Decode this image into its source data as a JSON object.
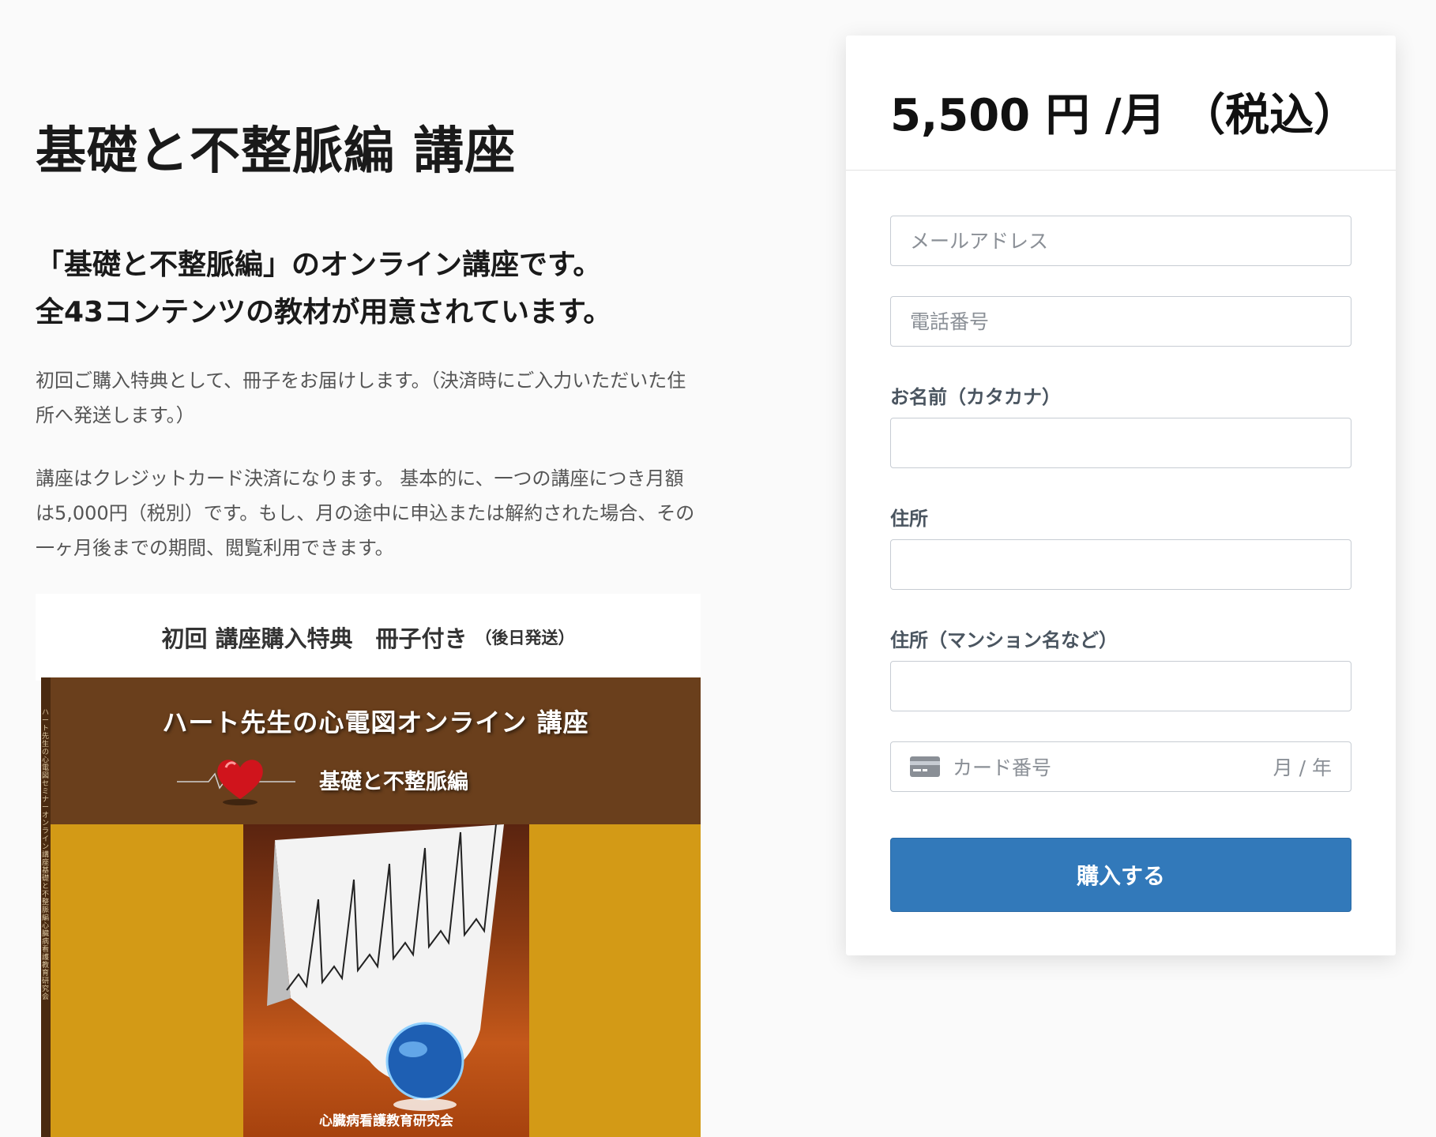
{
  "page": {
    "title": "基礎と不整脈編 講座",
    "lead_line1": "「基礎と不整脈編」のオンライン講座です。",
    "lead_line2": "全43コンテンツの教材が用意されています。",
    "para1": "初回ご購入特典として、冊子をお届けします。（決済時にご入力いただいた住所へ発送します。）",
    "para2": "講座はクレジットカード決済になります。 基本的に、一つの講座につき月額は5,000円（税別）です。もし、月の途中に申込または解約された場合、その一ヶ月後までの期間、閲覧利用できます。"
  },
  "bonus": {
    "title": "初回 講座購入特典　冊子付き",
    "note": "（後日発送）"
  },
  "cover": {
    "title": "ハート先生の心電図オンライン 講座",
    "subtitle": "基礎と不整脈編",
    "org": "心臓病看護教育研究会",
    "spine": "ハート先生の心電図セミナー　オンライン講座　基礎と不整脈編　心臓病看護教育研究会"
  },
  "payment": {
    "price": "5,500 円 /月 （税込）",
    "email_placeholder": "メールアドレス",
    "phone_placeholder": "電話番号",
    "name_label": "お名前（カタカナ）",
    "address_label": "住所",
    "address2_label": "住所（マンション名など）",
    "card_placeholder": "カード番号",
    "expiry_placeholder": "月 / 年",
    "buy_label": "購入する"
  },
  "colors": {
    "button": "#3279ba",
    "cover_brown": "#6a3f1c",
    "cover_gold": "#d39a16"
  }
}
